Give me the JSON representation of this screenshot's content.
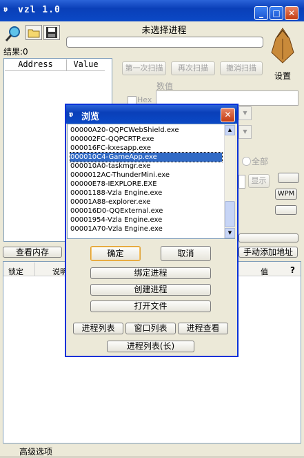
{
  "window": {
    "title": "vzl 1.0"
  },
  "header": {
    "process_label": "未选择进程",
    "results_label": "结果:0",
    "settings_label": "设置"
  },
  "address_list": {
    "col_address": "Address",
    "col_value": "Value"
  },
  "scan": {
    "first_scan": "第一次扫描",
    "next_scan": "再次扫描",
    "undo_scan": "撤消扫描",
    "value_label": "数值",
    "hex_label": "Hex",
    "all_option": "全部",
    "show_button": "显示",
    "wpm_button": "WPM"
  },
  "bottom": {
    "view_memory": "查看内存",
    "manual_add": "手动添加地址",
    "col_lock": "锁定",
    "col_desc": "说明",
    "col_value": "值",
    "help": "?",
    "advanced": "高级选项"
  },
  "dialog": {
    "title": "浏览",
    "processes": [
      "00000A20-QQPCWebShield.exe",
      "000002FC-QQPCRTP.exe",
      "000016FC-kxesapp.exe",
      "000010C4-GameApp.exe",
      "000010A0-taskmgr.exe",
      "0000012AC-ThunderMini.exe",
      "00000E78-IEXPLORE.EXE",
      "00001188-Vzla Engine.exe",
      "00001A88-explorer.exe",
      "000016D0-QQExternal.exe",
      "00001954-Vzla Engine.exe",
      "00001A70-Vzla Engine.exe"
    ],
    "selected_index": 3,
    "ok": "确定",
    "cancel": "取消",
    "bind_process": "绑定进程",
    "create_process": "创建进程",
    "open_file": "打开文件",
    "process_list": "进程列表",
    "window_list": "窗口列表",
    "process_view": "进程查看",
    "process_list_long": "进程列表(长)"
  }
}
